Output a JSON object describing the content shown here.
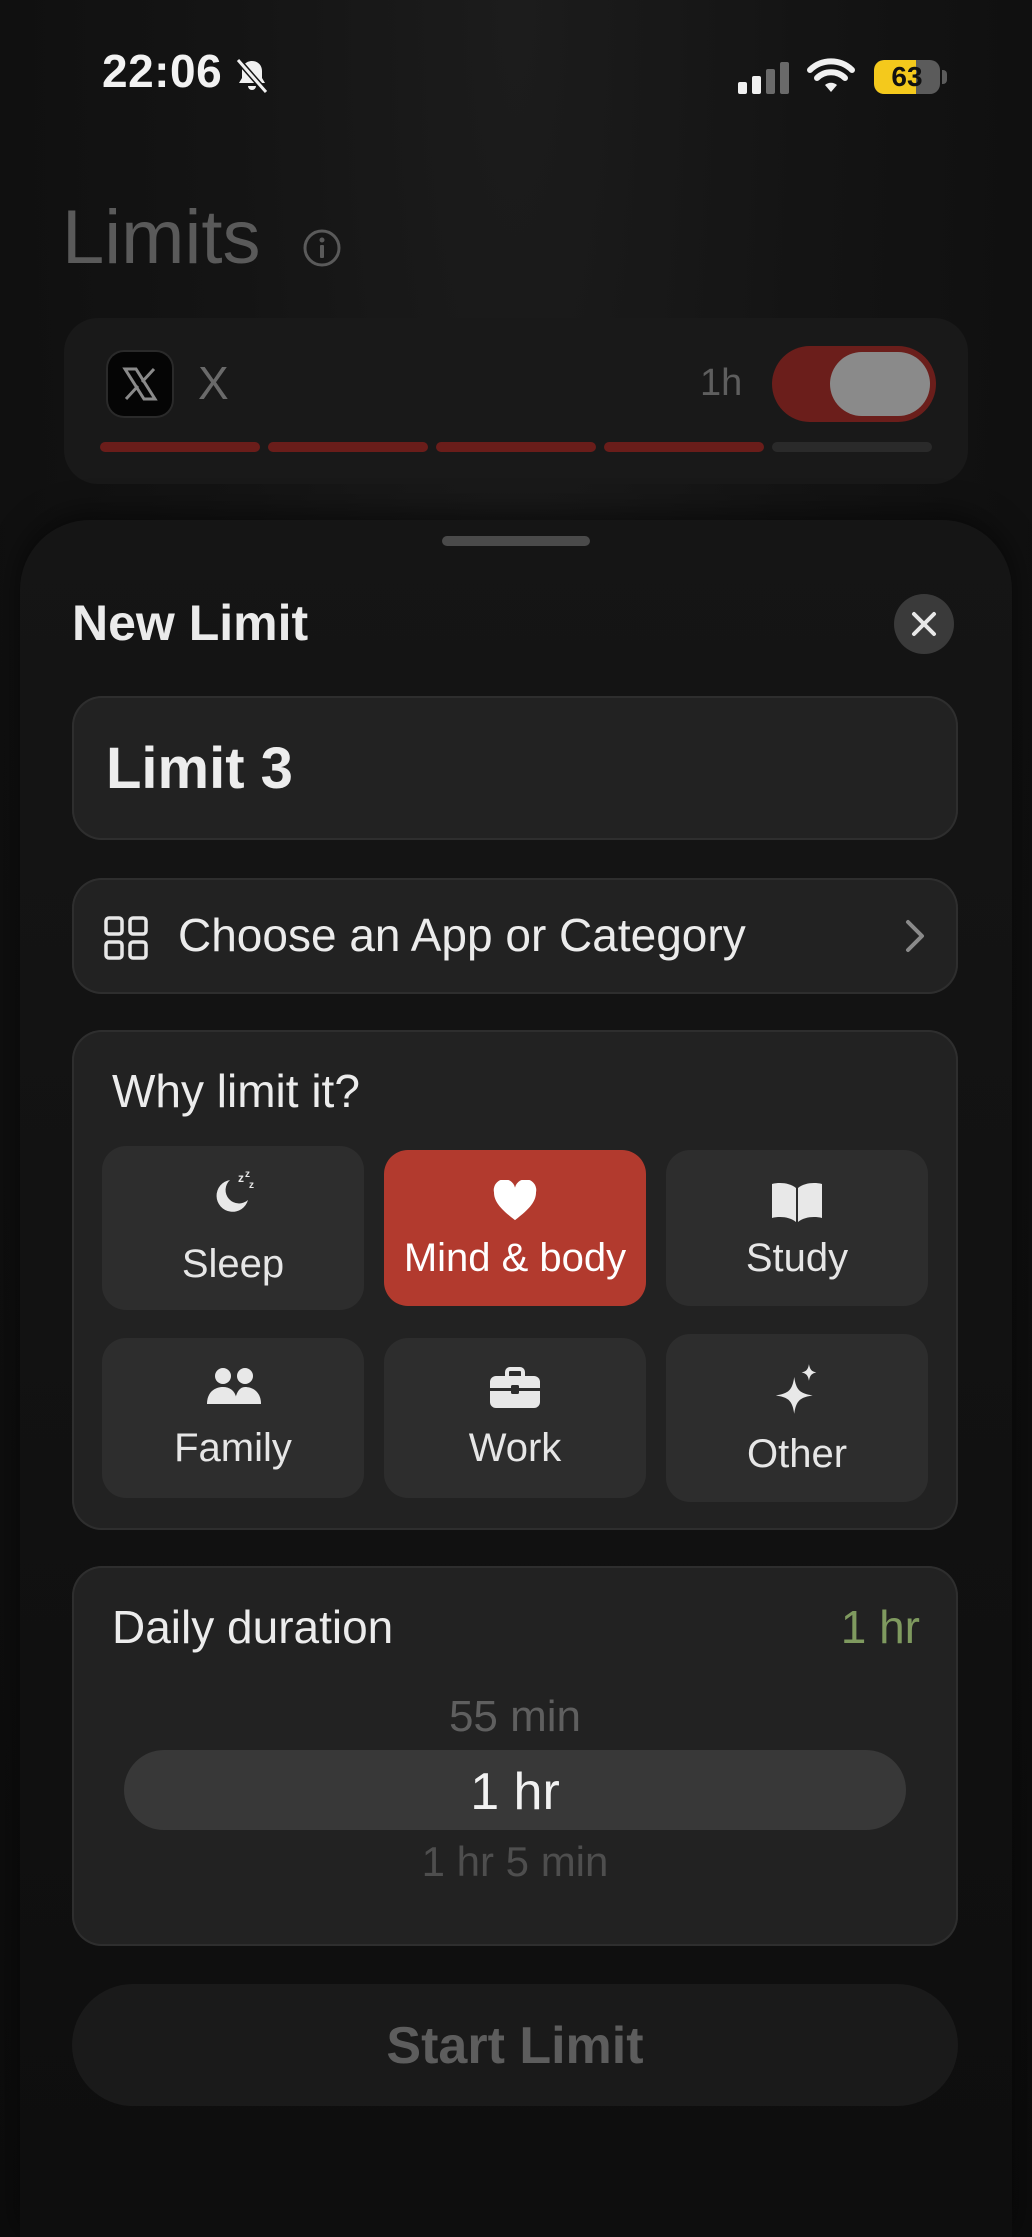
{
  "status_bar": {
    "time": "22:06",
    "battery_level": "63",
    "battery_fraction": 0.63,
    "icons": [
      "bell-slash-icon",
      "signal-icon",
      "wifi-icon",
      "battery-icon"
    ]
  },
  "background": {
    "title": "Limits",
    "card": {
      "app_name": "X",
      "limit": "1h",
      "toggle_on": true,
      "progress_segments_filled": 4,
      "progress_segments_total": 5
    }
  },
  "sheet": {
    "title": "New Limit",
    "name_value": "Limit 3",
    "choose_label": "Choose an App or Category",
    "why": {
      "title": "Why limit it?",
      "reasons": [
        {
          "label": "Sleep",
          "icon": "moon-zzz-icon",
          "selected": false
        },
        {
          "label": "Mind & body",
          "icon": "heart-icon",
          "selected": true
        },
        {
          "label": "Study",
          "icon": "book-icon",
          "selected": false
        },
        {
          "label": "Family",
          "icon": "people-icon",
          "selected": false
        },
        {
          "label": "Work",
          "icon": "briefcase-icon",
          "selected": false
        },
        {
          "label": "Other",
          "icon": "sparkles-icon",
          "selected": false
        }
      ]
    },
    "duration": {
      "title": "Daily duration",
      "value": "1 hr",
      "picker": {
        "previous": "55 min",
        "current": "1 hr",
        "next": "1 hr 5 min"
      }
    },
    "start_label": "Start Limit"
  },
  "colors": {
    "accent_red": "#b23a2e",
    "duration_green": "#7f9a5f",
    "battery_yellow": "#f4c91c"
  }
}
